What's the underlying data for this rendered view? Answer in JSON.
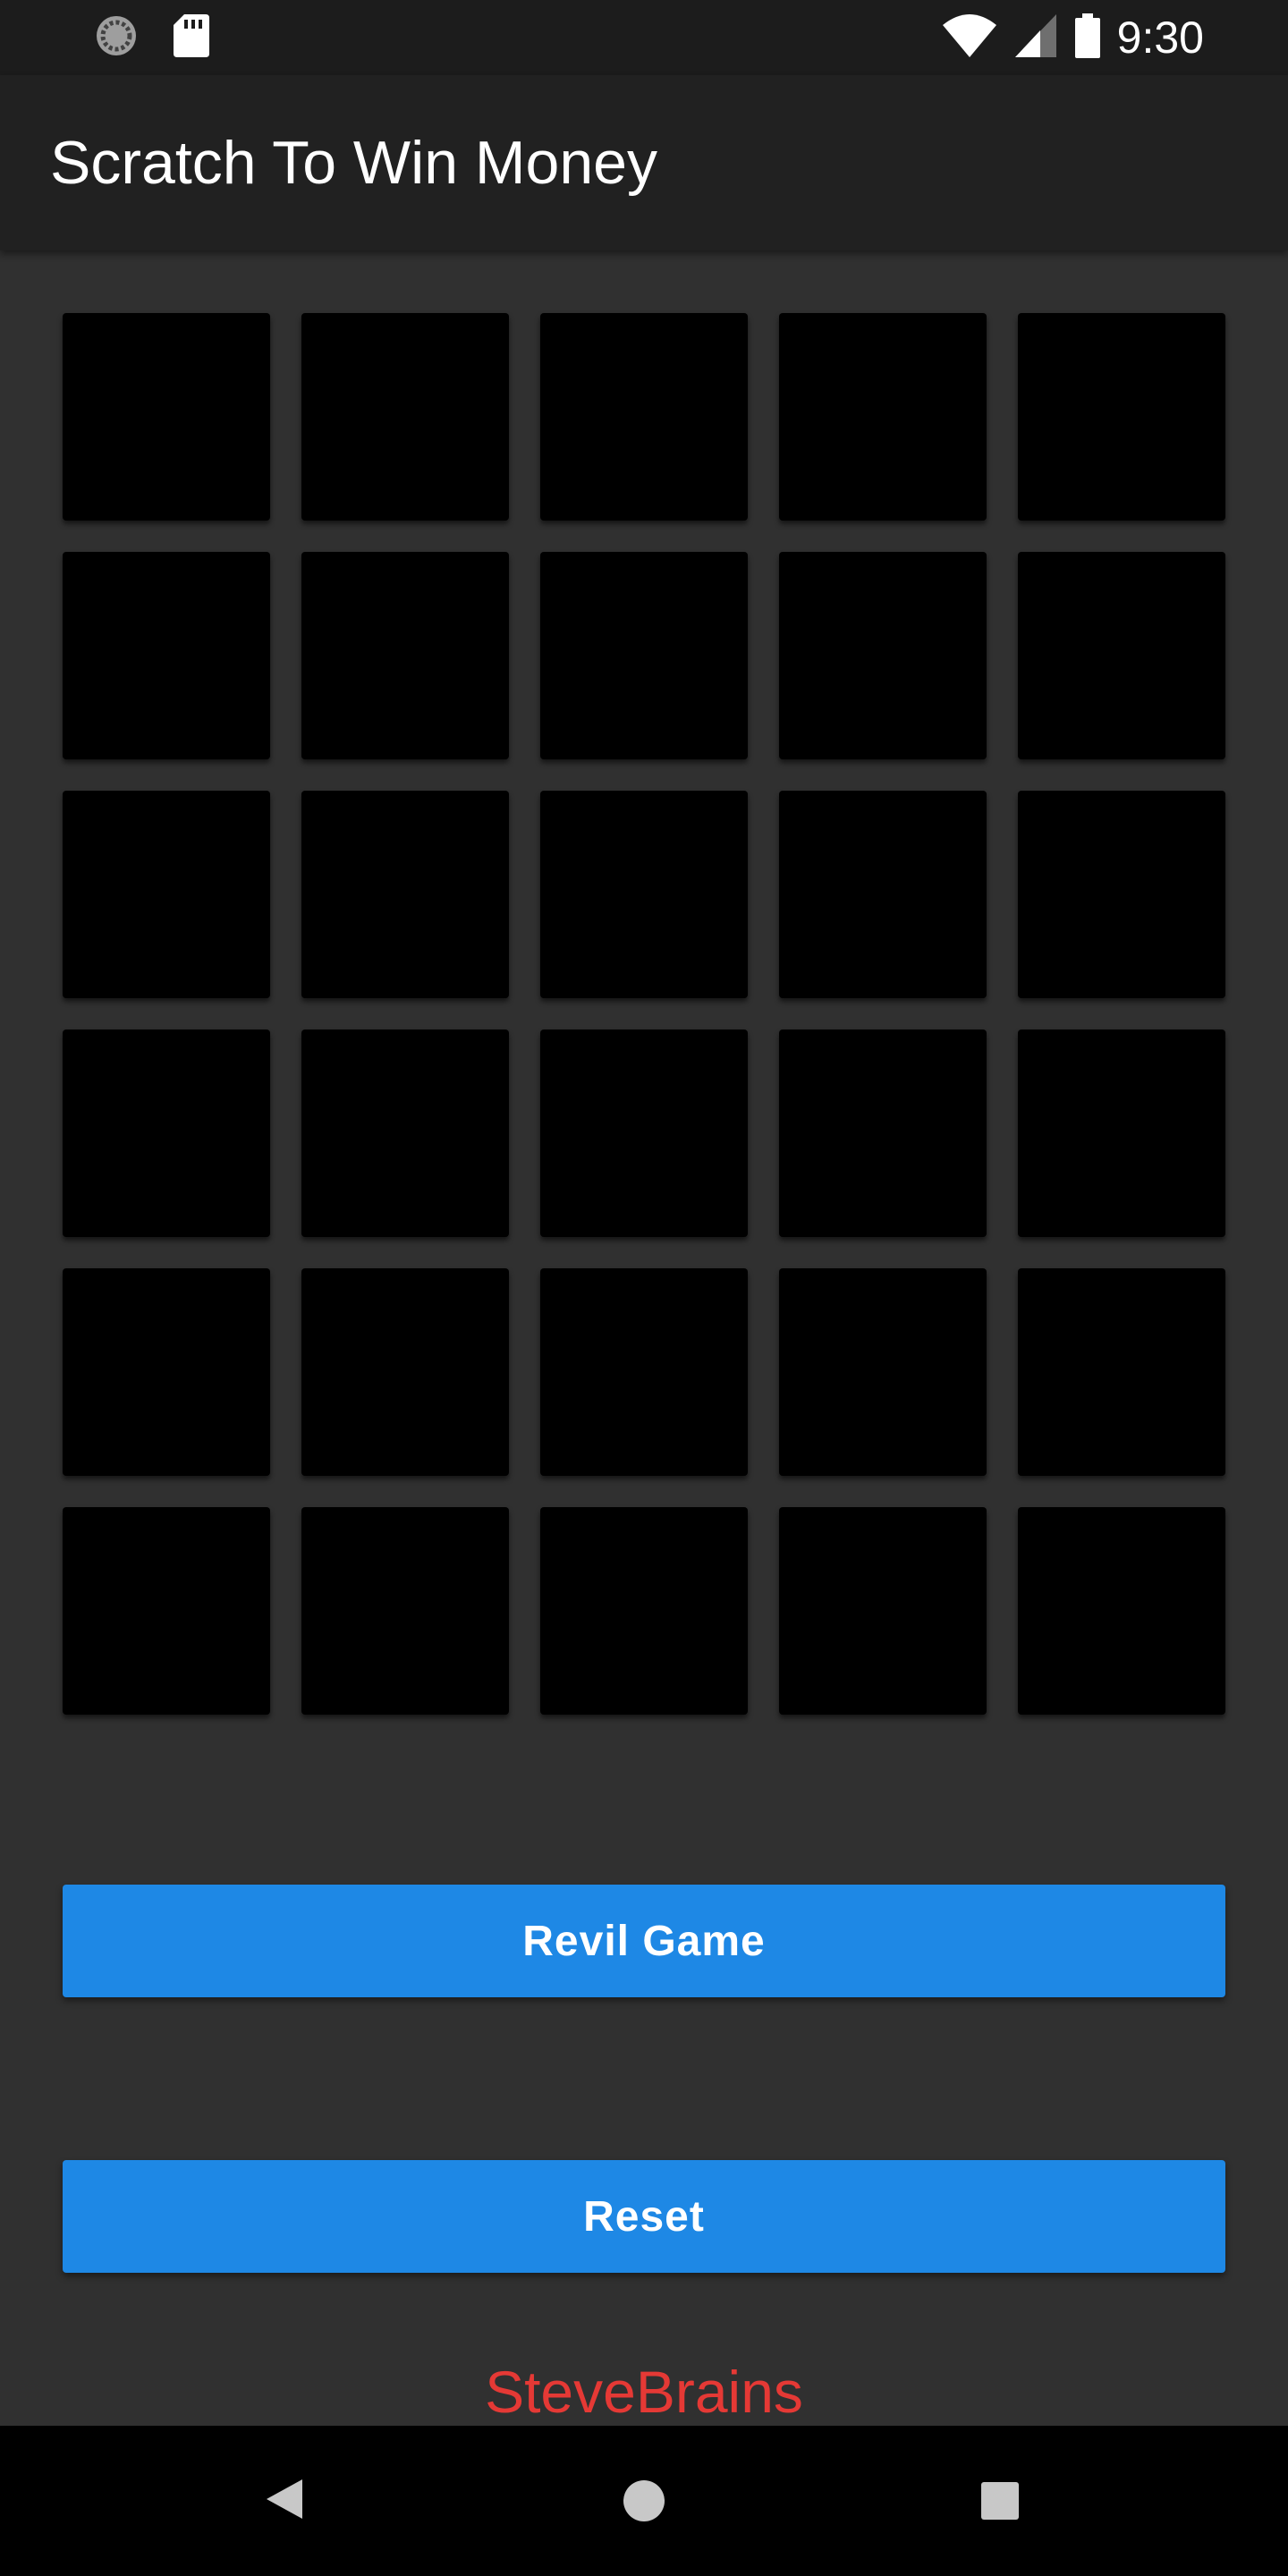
{
  "status_bar": {
    "time": "9:30",
    "left_icons": [
      "sync-icon",
      "sd-card-icon"
    ],
    "right_icons": [
      "wifi-icon",
      "cell-signal-icon",
      "battery-icon"
    ]
  },
  "app_bar": {
    "title": "Scratch To Win Money"
  },
  "board": {
    "rows": 6,
    "columns": 5,
    "tiles": [
      "",
      "",
      "",
      "",
      "",
      "",
      "",
      "",
      "",
      "",
      "",
      "",
      "",
      "",
      "",
      "",
      "",
      "",
      "",
      "",
      "",
      "",
      "",
      "",
      "",
      "",
      "",
      "",
      "",
      ""
    ],
    "tile_color": "#000000"
  },
  "buttons": {
    "reveal_label": "Revil Game",
    "reset_label": "Reset",
    "color": "#1e88e5"
  },
  "credit": {
    "text": "SteveBrains",
    "color": "#e53935"
  },
  "nav_bar": {
    "icons": [
      "back-icon",
      "home-icon",
      "recents-icon"
    ]
  },
  "colors": {
    "background": "#303030",
    "app_bar": "#212121",
    "status_bar": "#1c1c1c"
  }
}
